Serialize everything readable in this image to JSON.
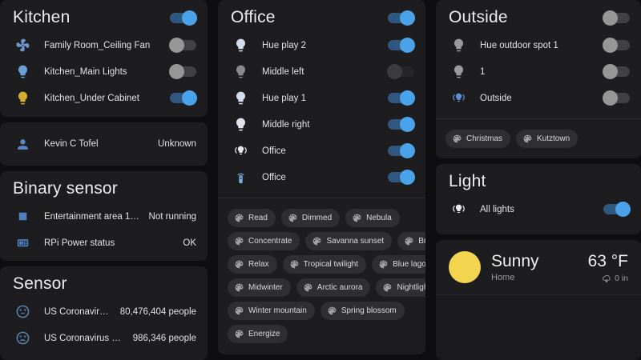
{
  "colors": {
    "page_bg": "#0e0e10",
    "card_bg": "#1d1d1f",
    "toggle_on_thumb": "#4aa3e8",
    "toggle_on_track": "#30587e",
    "toggle_off_thumb": "#969696",
    "icon_blue": "#6d9ed6",
    "icon_yellow": "#d4af2f",
    "sun_yellow": "#f2d44e"
  },
  "kitchen": {
    "title": "Kitchen",
    "header_toggle": "on",
    "rows": [
      {
        "icon": "fan-icon",
        "label": "Family Room_Ceiling Fan",
        "state": "off"
      },
      {
        "icon": "lightbulb-icon",
        "label": "Kitchen_Main Lights",
        "state": "off"
      },
      {
        "icon": "lightbulb-icon",
        "label": "Kitchen_Under Cabinet",
        "state": "on"
      }
    ]
  },
  "person": {
    "icon": "person-icon",
    "name": "Kevin C Tofel",
    "state": "Unknown"
  },
  "binary_sensor": {
    "title": "Binary sensor",
    "rows": [
      {
        "icon": "square-icon",
        "label": "Entertainment area 1: Entertain…",
        "value": "Not running"
      },
      {
        "icon": "raspberry-pi-icon",
        "label": "RPi Power status",
        "value": "OK"
      }
    ]
  },
  "sensor": {
    "title": "Sensor",
    "rows": [
      {
        "icon": "neutral-face-icon",
        "label": "US Coronavirus confirmed",
        "value": "80,476,404 people"
      },
      {
        "icon": "sad-face-icon",
        "label": "US Coronavirus deaths",
        "value": "986,346 people"
      }
    ]
  },
  "office": {
    "title": "Office",
    "header_toggle": "on",
    "rows": [
      {
        "icon": "lightbulb-icon",
        "label": "Hue play 2",
        "state": "on"
      },
      {
        "icon": "lightbulb-icon",
        "label": "Middle left",
        "state": "unavailable"
      },
      {
        "icon": "lightbulb-icon",
        "label": "Hue play 1",
        "state": "on"
      },
      {
        "icon": "lightbulb-icon",
        "label": "Middle right",
        "state": "on"
      },
      {
        "icon": "lightbulb-group-icon",
        "label": "Office",
        "state": "on"
      },
      {
        "icon": "remote-icon",
        "label": "Office",
        "state": "on"
      }
    ],
    "scenes": [
      "Read",
      "Dimmed",
      "Nebula",
      "Concentrate",
      "Savanna sunset",
      "Bright",
      "Relax",
      "Tropical twilight",
      "Blue lagoon",
      "Midwinter",
      "Arctic aurora",
      "Nightlight",
      "Winter mountain",
      "Spring blossom",
      "Energize"
    ]
  },
  "outside": {
    "title": "Outside",
    "header_toggle": "off",
    "rows": [
      {
        "icon": "lightbulb-icon",
        "label": "Hue outdoor spot 1",
        "state": "off"
      },
      {
        "icon": "lightbulb-icon",
        "label": "1",
        "state": "off"
      },
      {
        "icon": "lightbulb-group-icon",
        "label": "Outside",
        "state": "off"
      }
    ],
    "scenes": [
      "Christmas",
      "Kutztown"
    ]
  },
  "light": {
    "title": "Light",
    "rows": [
      {
        "icon": "lightbulb-group-icon",
        "label": "All lights",
        "state": "on"
      }
    ]
  },
  "weather": {
    "condition": "Sunny",
    "location": "Home",
    "temperature": "63 °F",
    "precipitation": "0 in"
  }
}
